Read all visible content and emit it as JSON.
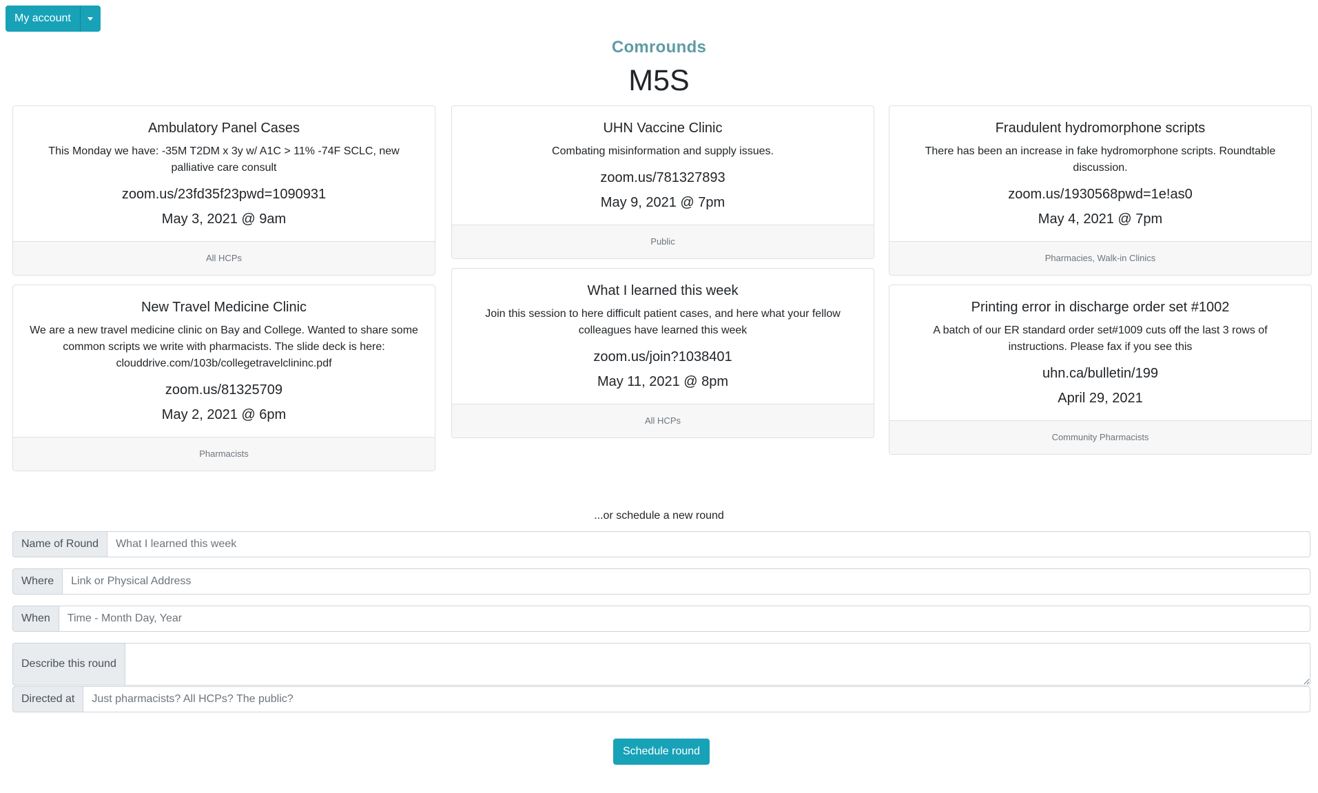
{
  "account": {
    "label": "My account",
    "caret_icon": "caret-down-icon"
  },
  "brand": "Comrounds",
  "region": "M5S",
  "cards": [
    {
      "title": "Ambulatory Panel Cases",
      "description": "This Monday we have: -35M T2DM x 3y w/ A1C > 11% -74F SCLC, new palliative care consult",
      "link": "zoom.us/23fd35f23pwd=1090931",
      "date": "May 3, 2021 @ 9am",
      "audience": "All HCPs"
    },
    {
      "title": "UHN Vaccine Clinic",
      "description": "Combating misinformation and supply issues.",
      "link": "zoom.us/781327893",
      "date": "May 9, 2021 @ 7pm",
      "audience": "Public"
    },
    {
      "title": "Fraudulent hydromorphone scripts",
      "description": "There has been an increase in fake hydromorphone scripts. Roundtable discussion.",
      "link": "zoom.us/1930568pwd=1e!as0",
      "date": "May 4, 2021 @ 7pm",
      "audience": "Pharmacies, Walk-in Clinics"
    },
    {
      "title": "New Travel Medicine Clinic",
      "description": "We are a new travel medicine clinic on Bay and College. Wanted to share some common scripts we write with pharmacists. The slide deck is here: clouddrive.com/103b/collegetravelclininc.pdf",
      "link": "zoom.us/81325709",
      "date": "May 2, 2021 @ 6pm",
      "audience": "Pharmacists"
    },
    {
      "title": "What I learned this week",
      "description": "Join this session to here difficult patient cases, and here what your fellow colleagues have learned this week",
      "link": "zoom.us/join?1038401",
      "date": "May 11, 2021 @ 8pm",
      "audience": "All HCPs"
    },
    {
      "title": "Printing error in discharge order set #1002",
      "description": "A batch of our ER standard order set#1009 cuts off the last 3 rows of instructions. Please fax if you see this",
      "link": "uhn.ca/bulletin/199",
      "date": "April 29, 2021",
      "audience": "Community Pharmacists"
    }
  ],
  "form": {
    "heading": "...or schedule a new round",
    "name": {
      "label": "Name of Round",
      "placeholder": "What I learned this week"
    },
    "where": {
      "label": "Where",
      "placeholder": "Link or Physical Address"
    },
    "when": {
      "label": "When",
      "placeholder": "Time - Month Day, Year"
    },
    "describe": {
      "label": "Describe this round",
      "placeholder": ""
    },
    "directed": {
      "label": "Directed at",
      "placeholder": "Just pharmacists? All HCPs? The public?"
    },
    "submit_label": "Schedule round"
  }
}
